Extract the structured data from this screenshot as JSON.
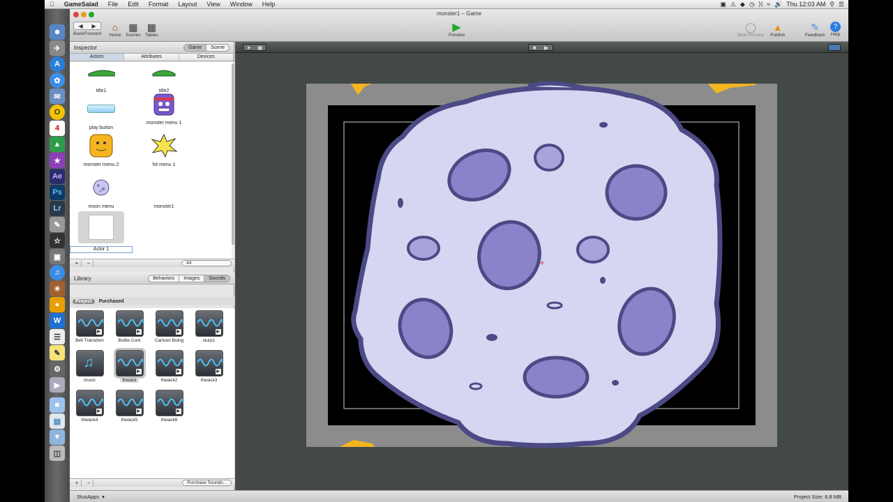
{
  "menubar": {
    "app_name": "GameSalad",
    "items": [
      "File",
      "Edit",
      "Format",
      "Layout",
      "View",
      "Window",
      "Help"
    ],
    "clock": "Thu 12:03 AM"
  },
  "window": {
    "title": "monster1 – Game"
  },
  "toolbar": {
    "back_forward": "Back/Forward",
    "home": "Home",
    "scenes": "Scenes",
    "tables": "Tables",
    "preview": "Preview",
    "web_preview": "Web Preview",
    "publish": "Publish",
    "feedback": "Feedback",
    "help": "Help"
  },
  "inspector": {
    "title": "Inspector",
    "toggle": [
      "Game",
      "Scene"
    ],
    "tabs": [
      "Actors",
      "Attributes",
      "Devices"
    ],
    "actors": [
      {
        "name": "title1"
      },
      {
        "name": "title2"
      },
      {
        "name": "play button"
      },
      {
        "name": "monster menu 1"
      },
      {
        "name": "monster menu 2"
      },
      {
        "name": "hit menu 1"
      },
      {
        "name": "moon menu"
      },
      {
        "name": "monster1"
      }
    ],
    "new_actor_name": "Actor 1",
    "filter": "All"
  },
  "library": {
    "title": "Library",
    "toggle": [
      "Behaviors",
      "Images",
      "Sounds"
    ],
    "subtabs": [
      "Project",
      "Purchased"
    ],
    "sounds": [
      {
        "name": "Bell Transition"
      },
      {
        "name": "Bottle Cork"
      },
      {
        "name": "Cartoon Boing"
      },
      {
        "name": "slurp1"
      },
      {
        "name": "music"
      },
      {
        "name": "thwack"
      },
      {
        "name": "thwack2"
      },
      {
        "name": "thwack3"
      },
      {
        "name": "thwack4"
      },
      {
        "name": "thwack5"
      },
      {
        "name": "thwack6"
      }
    ],
    "purchase_label": "Purchase Sounds..."
  },
  "status": {
    "user": "StusApps",
    "project_size": "Project Size: 6.8 MB"
  },
  "colors": {
    "stage_bg": "#434947",
    "moon_fill": "#d6d6f2",
    "moon_outline": "#4b4a85",
    "crater": "#8a83c9"
  }
}
